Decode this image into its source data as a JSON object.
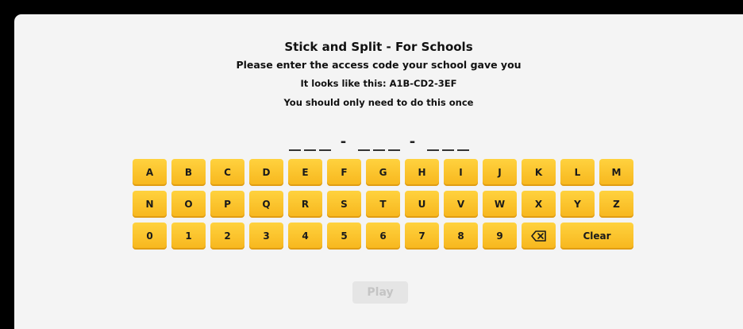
{
  "header": {
    "title": "Stick and Split - For Schools",
    "instruction": "Please enter the access code your school gave you",
    "example": "It looks like this: A1B-CD2-3EF",
    "note": "You should only need to do this once"
  },
  "code": {
    "separator": "-"
  },
  "keyboard": {
    "row1": [
      "A",
      "B",
      "C",
      "D",
      "E",
      "F",
      "G",
      "H",
      "I",
      "J",
      "K",
      "L",
      "M"
    ],
    "row2": [
      "N",
      "O",
      "P",
      "Q",
      "R",
      "S",
      "T",
      "U",
      "V",
      "W",
      "X",
      "Y",
      "Z"
    ],
    "row3": [
      "0",
      "1",
      "2",
      "3",
      "4",
      "5",
      "6",
      "7",
      "8",
      "9"
    ],
    "clear_label": "Clear",
    "backspace_icon": "backspace-icon"
  },
  "play": {
    "label": "Play"
  },
  "colors": {
    "key": "#f9c12e",
    "panel": "#f4f4f4",
    "play_disabled": "#e5e5e5"
  }
}
